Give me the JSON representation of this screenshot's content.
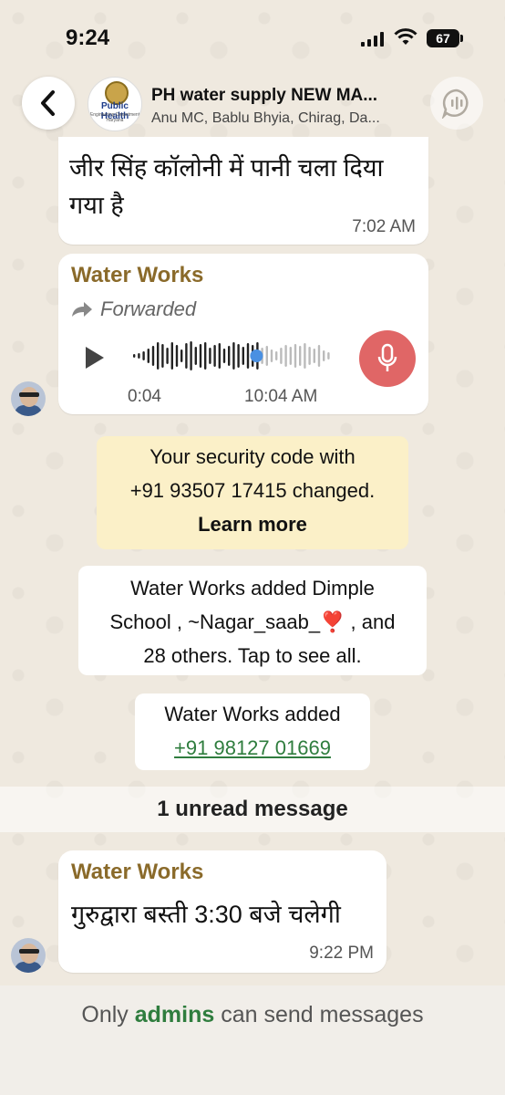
{
  "status_bar": {
    "time": "9:24",
    "battery": "67"
  },
  "header": {
    "group_name": "PH water supply NEW MA...",
    "members": "Anu MC, Bablu Bhyia, Chirag, Da...",
    "avatar_text": "Public Health",
    "avatar_subtext": "Engineering Department Haryana"
  },
  "messages": [
    {
      "text": "जीर सिंह कॉलोनी में पानी चला दिया गया है",
      "time": "7:02 AM"
    },
    {
      "sender": "Water Works",
      "forwarded_label": "Forwarded",
      "voice_duration": "0:04",
      "time": "10:04 AM",
      "playback_progress": 0.62
    },
    {
      "sender": "Water Works",
      "text": "गुरुद्वारा बस्ती  3:30 बजे चलेगी",
      "time": "9:22 PM"
    }
  ],
  "system": {
    "security_line1": "Your security code with",
    "security_line2": "+91 93507 17415 changed.",
    "security_link": "Learn more",
    "added1_line1": "Water Works  added Dimple",
    "added1_line2": "School , ~Nagar_saab_❣️ , and",
    "added1_line3": "28 others. Tap to see all.",
    "added2_line1": "Water Works  added",
    "added2_phone": "+91 98127 01669"
  },
  "unread_banner": "1 unread message",
  "footer": {
    "prefix": "Only",
    "admins": "admins",
    "suffix": "can send messages"
  },
  "colors": {
    "sender": "#8a6a2a",
    "link": "#2f7d3e",
    "mic": "#e06666",
    "system_yellow": "#fbf0c8"
  }
}
